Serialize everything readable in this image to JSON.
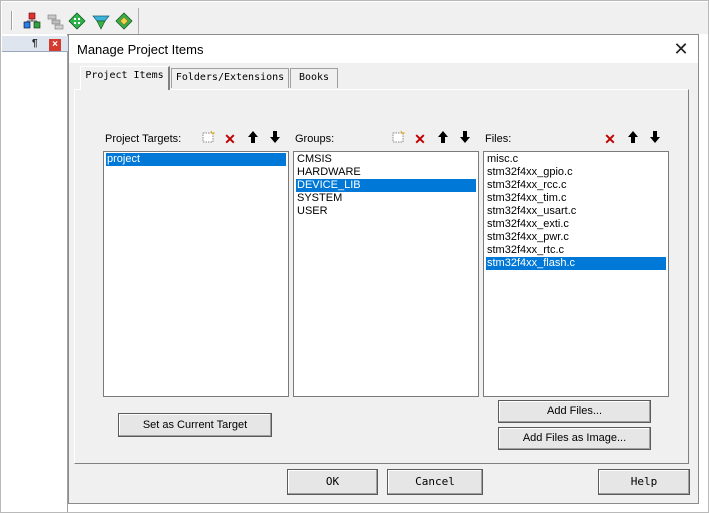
{
  "ide": {
    "toolbar_icons": [
      "project-window-icon",
      "books-icon",
      "manage-components-icon",
      "pack-installer-icon",
      "select-software-packs-icon"
    ]
  },
  "dialog": {
    "title": "Manage Project Items",
    "close_glyph": "✕",
    "tabs": [
      {
        "label": "Project Items",
        "active": true
      },
      {
        "label": "Folders/Extensions",
        "active": false
      },
      {
        "label": "Books",
        "active": false
      }
    ],
    "targets": {
      "label": "Project Targets:",
      "items": [
        {
          "label": "project",
          "selected": true
        }
      ]
    },
    "groups": {
      "label": "Groups:",
      "items": [
        {
          "label": "CMSIS",
          "selected": false
        },
        {
          "label": "HARDWARE",
          "selected": false
        },
        {
          "label": "DEVICE_LIB",
          "selected": true
        },
        {
          "label": "SYSTEM",
          "selected": false
        },
        {
          "label": "USER",
          "selected": false
        }
      ]
    },
    "files": {
      "label": "Files:",
      "items": [
        {
          "label": "misc.c",
          "selected": false
        },
        {
          "label": "stm32f4xx_gpio.c",
          "selected": false
        },
        {
          "label": "stm32f4xx_rcc.c",
          "selected": false
        },
        {
          "label": "stm32f4xx_tim.c",
          "selected": false
        },
        {
          "label": "stm32f4xx_usart.c",
          "selected": false
        },
        {
          "label": "stm32f4xx_exti.c",
          "selected": false
        },
        {
          "label": "stm32f4xx_pwr.c",
          "selected": false
        },
        {
          "label": "stm32f4xx_rtc.c",
          "selected": false
        },
        {
          "label": "stm32f4xx_flash.c",
          "selected": true
        }
      ]
    },
    "buttons": {
      "set_current_target": "Set as Current Target",
      "add_files": "Add Files...",
      "add_files_image": "Add Files as Image...",
      "ok": "OK",
      "cancel": "Cancel",
      "help": "Help"
    },
    "glyphs": {
      "delete": "✕",
      "up": "🡅",
      "down": "🡇",
      "new": "⬚"
    },
    "colors": {
      "selection": "#0078d7",
      "delete_icon": "#c00000"
    }
  }
}
